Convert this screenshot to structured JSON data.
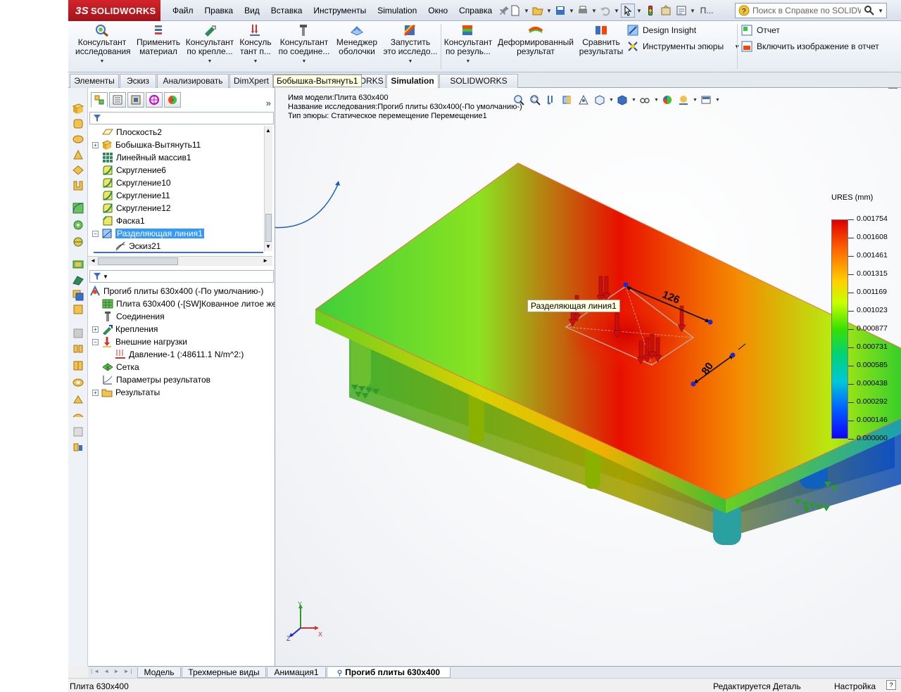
{
  "app": {
    "brand_ds": "3S",
    "brand_name": "SOLIDWORKS"
  },
  "menu": [
    "Файл",
    "Правка",
    "Вид",
    "Вставка",
    "Инструменты",
    "Simulation",
    "Окно",
    "Справка"
  ],
  "qat_overflow": "П...",
  "search": {
    "placeholder": "Поиск в Справке по SOLIDWC"
  },
  "ribbon": {
    "consultant_study": [
      "Консультант",
      "исследования"
    ],
    "apply_material": [
      "Применить",
      "материал"
    ],
    "fixture_advisor": [
      "Консультант",
      "по крепле..."
    ],
    "load_advisor": [
      "Консуль",
      "тант п..."
    ],
    "connection_advisor": [
      "Консультант",
      "по соедине..."
    ],
    "shell_manager": [
      "Менеджер",
      "оболочки"
    ],
    "run_study": [
      "Запустить",
      "это исследо..."
    ],
    "results_advisor": [
      "Консультант",
      "по резуль..."
    ],
    "deformed_result": [
      "Деформированный",
      "результат"
    ],
    "compare_results": [
      "Сравнить",
      "результаты"
    ],
    "design_insight": "Design Insight",
    "plot_tools": "Инструменты эпюры",
    "report": "Отчет",
    "include_image": "Включить изображение в отчет"
  },
  "tabs": [
    "Элементы",
    "Эскиз",
    "Анализировать",
    "DimXpert",
    "Добавления SOLIDWORKS",
    "Simulation",
    "SOLIDWORKS MBD"
  ],
  "feature_tree": [
    {
      "label": "Плоскость2",
      "icon": "plane-icon"
    },
    {
      "label": "Бобышка-Вытянуть11",
      "icon": "boss-extrude-icon"
    },
    {
      "label": "Линейный массив1",
      "icon": "linear-pattern-icon"
    },
    {
      "label": "Скругление6",
      "icon": "fillet-icon"
    },
    {
      "label": "Скругление10",
      "icon": "fillet-icon"
    },
    {
      "label": "Скругление11",
      "icon": "fillet-icon"
    },
    {
      "label": "Скругление12",
      "icon": "fillet-icon"
    },
    {
      "label": "Фаска1",
      "icon": "chamfer-icon"
    },
    {
      "label": "Разделяющая линия1",
      "icon": "split-line-icon"
    },
    {
      "label": "Эскиз21",
      "icon": "sketch-icon"
    }
  ],
  "study_tree": [
    {
      "label": "Прогиб плиты 630x400 (-По умолчанию-)"
    },
    {
      "label": "Плита 630x400 (-[SW]Кованное литое жел"
    },
    {
      "label": "Соединения"
    },
    {
      "label": "Крепления"
    },
    {
      "label": "Внешние нагрузки"
    },
    {
      "label": "Давление-1 (:48611.1 N/m^2:)"
    },
    {
      "label": "Сетка"
    },
    {
      "label": "Параметры результатов"
    },
    {
      "label": "Результаты"
    }
  ],
  "tooltip_tree": "Бобышка-Вытянуть1",
  "tooltip_view": "Разделяющая линия1",
  "model_info": {
    "line1": "Имя модели:Плита 630x400",
    "line2": "Название исследования:Прогиб плиты 630x400(-По умолчанию-)",
    "line3": "Тип эпюры: Статическое перемещение Перемещение1"
  },
  "legend": {
    "title": "URES (mm)",
    "values": [
      "0.001754",
      "0.001608",
      "0.001461",
      "0.001315",
      "0.001169",
      "0.001023",
      "0.000877",
      "0.000731",
      "0.000585",
      "0.000438",
      "0.000292",
      "0.000146",
      "0.000000"
    ]
  },
  "dims": {
    "d1": "126",
    "d2": "80"
  },
  "triad": {
    "x": "X",
    "y": "Y",
    "z": "Z"
  },
  "bottom_tabs": [
    "Модель",
    "Трехмерные виды",
    "Анимация1",
    "Прогиб плиты 630x400"
  ],
  "status": {
    "left": "Плита 630x400",
    "mid": "Редактируется Деталь",
    "right": "Настройка"
  }
}
